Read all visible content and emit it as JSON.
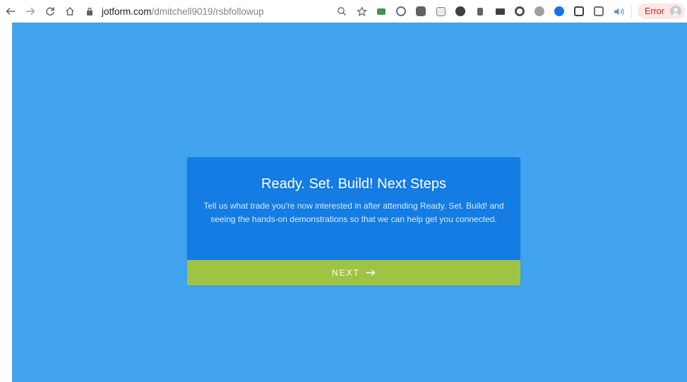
{
  "browser": {
    "url_host": "jotform.com",
    "url_path": "/dmitchell9019/rsbfollowup",
    "error_label": "Error"
  },
  "form": {
    "title": "Ready. Set. Build! Next Steps",
    "description": "Tell us what trade you're now interested in after attending Ready. Set. Build! and seeing the hands-on demonstrations so that we can help get you connected.",
    "next_label": "NEXT"
  },
  "colors": {
    "page_background": "#42a3ef",
    "card_background": "#147ce2",
    "next_button": "#9ec443"
  },
  "icons": {
    "nav": [
      "back-arrow-icon",
      "forward-arrow-icon",
      "reload-icon",
      "home-icon"
    ],
    "next": "right-arrow-icon"
  }
}
